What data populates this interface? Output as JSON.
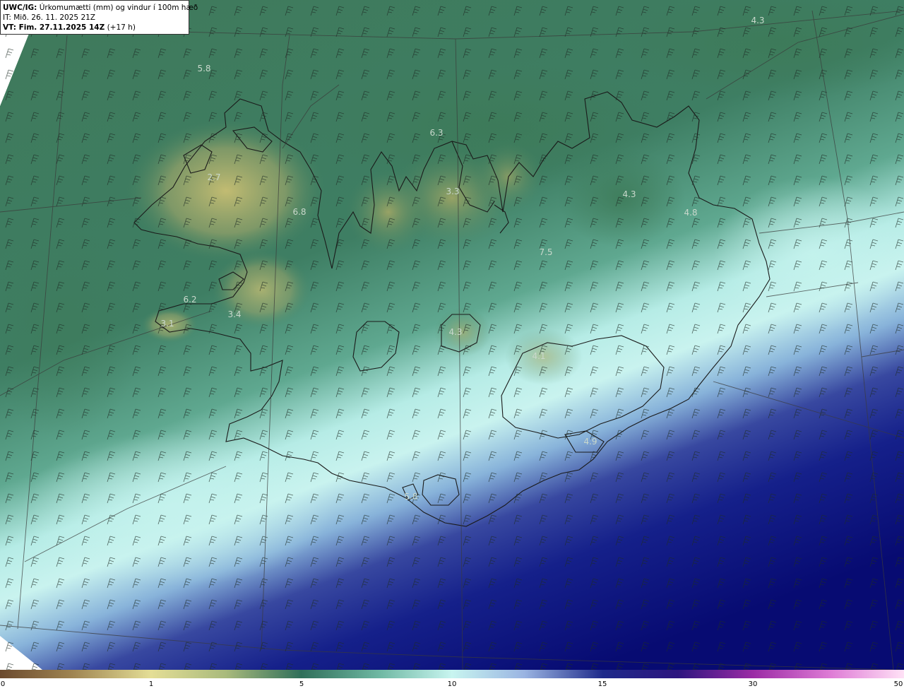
{
  "header": {
    "line1_bold": "UWC/IG:",
    "line1_rest": "Úrkomumætti (mm) og vindur í 100m hæð",
    "line2": "IT: Mið. 26. 11. 2025 21Z",
    "line3_bold": "VT: Fim. 27.11.2025 14Z",
    "line3_rest": "(+17 h)"
  },
  "value_labels": [
    {
      "text": "4.3"
    },
    {
      "text": "5.8"
    },
    {
      "text": "6.3"
    },
    {
      "text": "2.7"
    },
    {
      "text": "3.3"
    },
    {
      "text": "4.3"
    },
    {
      "text": "4.8"
    },
    {
      "text": "6.8"
    },
    {
      "text": "7.5"
    },
    {
      "text": "6.2"
    },
    {
      "text": "3.1"
    },
    {
      "text": "3.4"
    },
    {
      "text": "4.3"
    },
    {
      "text": "4.1"
    },
    {
      "text": "4.9"
    },
    {
      "text": "5.8"
    }
  ],
  "colorbar": {
    "ticks": [
      "0",
      "1",
      "5",
      "10",
      "15",
      "30",
      "50"
    ],
    "colors": [
      "#6b4a2e",
      "#c7b36a",
      "#e7e39a",
      "#5f9e6f",
      "#2f6f5a",
      "#aef0ec",
      "#a9c7ea",
      "#1e2a8a",
      "#070a6e",
      "#7a1fa0",
      "#e07ad6",
      "#ffd0f2"
    ]
  },
  "legend_colors": {
    "sea_dark_green": "#3f7a5f",
    "land_yellow": "#b7b46a",
    "cyan": "#bff1ec",
    "navy": "#0a1275"
  }
}
